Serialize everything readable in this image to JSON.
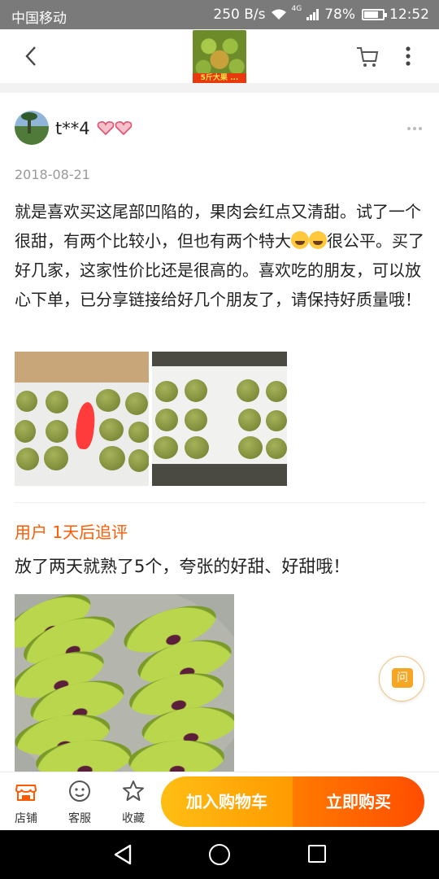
{
  "status_bar": {
    "carrier": "中国移动",
    "network_speed": "250 B/s",
    "network_type": "4G",
    "battery": "78%",
    "battery_level": 0.78,
    "time": "12:52"
  },
  "header": {
    "back_icon": "chevron-left-icon",
    "product_thumb_banner": "5斤大果 ...",
    "cart_icon": "shopping-cart-icon",
    "more_icon": "vertical-dots-icon"
  },
  "review": {
    "username": "t**4",
    "badge_icon": "hearts-icon",
    "more_icon": "horizontal-dots-icon",
    "date": "2018-08-21",
    "text_part1": "就是喜欢买这尾部凹陷的，果肉会红点又清甜。试了一个很甜，有两个比较小，但也有两个特大",
    "emoji_name": "grinning-sweat-emoji",
    "text_part2": "很公平。买了好几家，这家性价比还是很高的。喜欢吃的朋友，可以放心下单，已分享链接给好几个朋友了，请保持好质量哦！"
  },
  "follow_up": {
    "title": "用户 1天后追评",
    "text": "放了两天就熟了5个，夸张的好甜、好甜哦！"
  },
  "floating": {
    "ask_label": "问"
  },
  "bottom_bar": {
    "shop_label": "店铺",
    "service_label": "客服",
    "favorite_label": "收藏",
    "add_cart_label": "加入购物车",
    "buy_now_label": "立即购买",
    "accent_color": "#ff5a00",
    "cart_color": "#ffb000"
  },
  "nav_bar": {
    "back_icon": "triangle-back-icon",
    "home_icon": "circle-home-icon",
    "recent_icon": "square-recent-icon"
  }
}
